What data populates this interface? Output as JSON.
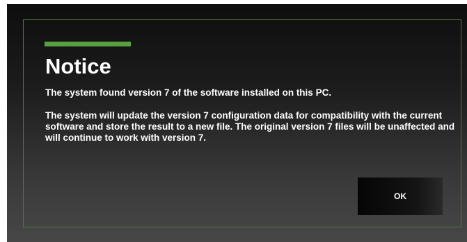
{
  "dialog": {
    "title": "Notice",
    "message_line": "The system found version 7 of the software installed on this PC.",
    "message_detail": "The system will update the version 7 configuration data for compatibility with the current software and store the result to a new file.  The original version 7 files will be unaffected and will continue to work with version 7.",
    "ok_label": "OK",
    "accent_color": "#57a03f",
    "border_color": "#4d7a3a"
  }
}
